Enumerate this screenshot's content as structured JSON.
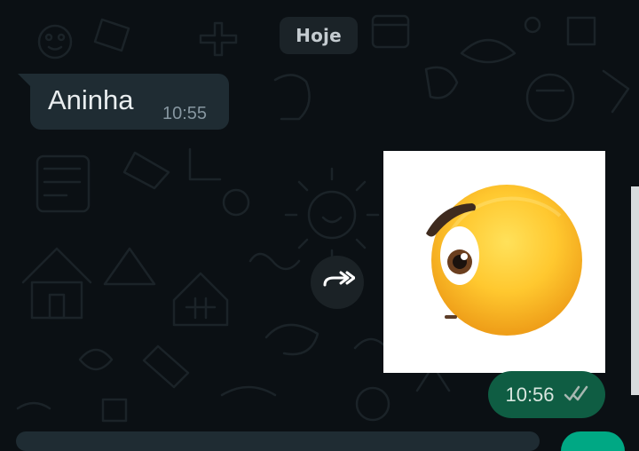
{
  "chat": {
    "date_chip": "Hoje",
    "messages": [
      {
        "type": "incoming_text",
        "text": "Aninha",
        "time": "10:55"
      },
      {
        "type": "outgoing_sticker",
        "sticker_name": "face-with-raised-eyebrow-sticker",
        "time": "10:56",
        "status": "double-check"
      }
    ]
  },
  "icons": {
    "forward": "forward-icon",
    "read_receipt": "double-check-icon"
  },
  "colors": {
    "background": "#0b1014",
    "incoming_bubble": "#1f2c33",
    "outgoing_bubble": "#0f5d43",
    "accent": "#00a884"
  }
}
